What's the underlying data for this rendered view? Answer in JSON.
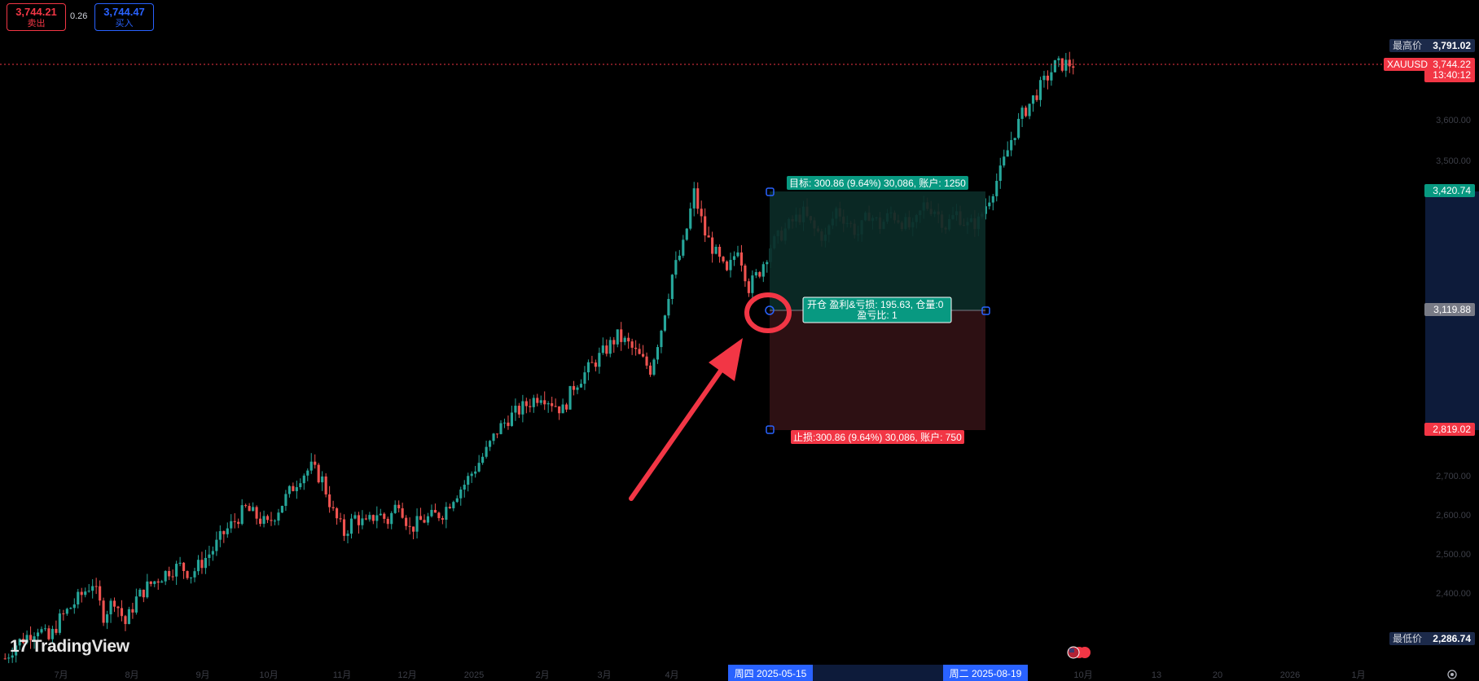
{
  "trade_panel": {
    "sell": {
      "price": "3,744.21",
      "label": "卖出"
    },
    "spread": "0.26",
    "buy": {
      "price": "3,744.47",
      "label": "买入"
    }
  },
  "brand": {
    "logo_mark": "17",
    "logo_text": "TradingView"
  },
  "price_axis": {
    "ticks": [
      "3,600.00",
      "3,500.00",
      "2,700.00",
      "2,600.00",
      "2,500.00",
      "2,400.00"
    ],
    "high": {
      "label": "最高价",
      "value": "3,791.02"
    },
    "symbol": {
      "label": "XAUUSD",
      "value": "3,744.22",
      "countdown": "13:40:12"
    },
    "target": "3,420.74",
    "entry": "3,119.88",
    "stop": "2,819.02",
    "low": {
      "label": "最低价",
      "value": "2,286.74"
    }
  },
  "time_axis": {
    "labels": [
      "7月",
      "8月",
      "9月",
      "10月",
      "11月",
      "12月",
      "2025",
      "2月",
      "3月",
      "4月",
      "10月",
      "13",
      "20",
      "2026",
      "1月"
    ],
    "range_start": "周四 2025-05-15",
    "range_end": "周二 2025-08-19"
  },
  "position_tool": {
    "target_label": "目标: 300.86 (9.64%) 30,086, 账户: 1250",
    "entry_line1": "开仓 盈利&亏损: 195.63, 仓量:0",
    "entry_line2": "盈亏比: 1",
    "stop_label": "止损:300.86 (9.64%) 30,086, 账户: 750"
  },
  "colors": {
    "up": "#26a69a",
    "down": "#ef5350",
    "profit_zone": "#0b2b27",
    "loss_zone": "#2f1114",
    "accent": "#2962ff",
    "annotation": "#f23645"
  },
  "chart_data": {
    "type": "candlestick",
    "symbol": "XAUUSD",
    "period_start": "2024-06",
    "period_end": "2025-09",
    "ylim": [
      2240,
      3900
    ],
    "high": 3791.02,
    "low": 2286.74,
    "last": 3744.22,
    "closes": [
      2295,
      2330,
      2350,
      2370,
      2340,
      2390,
      2420,
      2450,
      2480,
      2400,
      2440,
      2380,
      2440,
      2470,
      2490,
      2510,
      2520,
      2500,
      2530,
      2560,
      2600,
      2630,
      2660,
      2640,
      2620,
      2660,
      2700,
      2740,
      2760,
      2730,
      2650,
      2600,
      2640,
      2620,
      2650,
      2630,
      2680,
      2610,
      2630,
      2640,
      2650,
      2690,
      2720,
      2760,
      2800,
      2850,
      2880,
      2900,
      2920,
      2940,
      2920,
      2900,
      2960,
      2990,
      3020,
      3050,
      3080,
      3060,
      3030,
      3000,
      3100,
      3230,
      3300,
      3430,
      3330,
      3280,
      3230,
      3300,
      3200,
      3240,
      3300,
      3330,
      3360,
      3380,
      3340,
      3320,
      3390,
      3360,
      3330,
      3380,
      3350,
      3380,
      3360,
      3340,
      3400,
      3390,
      3350,
      3380,
      3350,
      3360,
      3420,
      3480,
      3560,
      3620,
      3660,
      3700,
      3740,
      3744
    ],
    "annotations": [
      "red circle highlighting the long-position entry point",
      "red arrow pointing to the entry point"
    ]
  }
}
